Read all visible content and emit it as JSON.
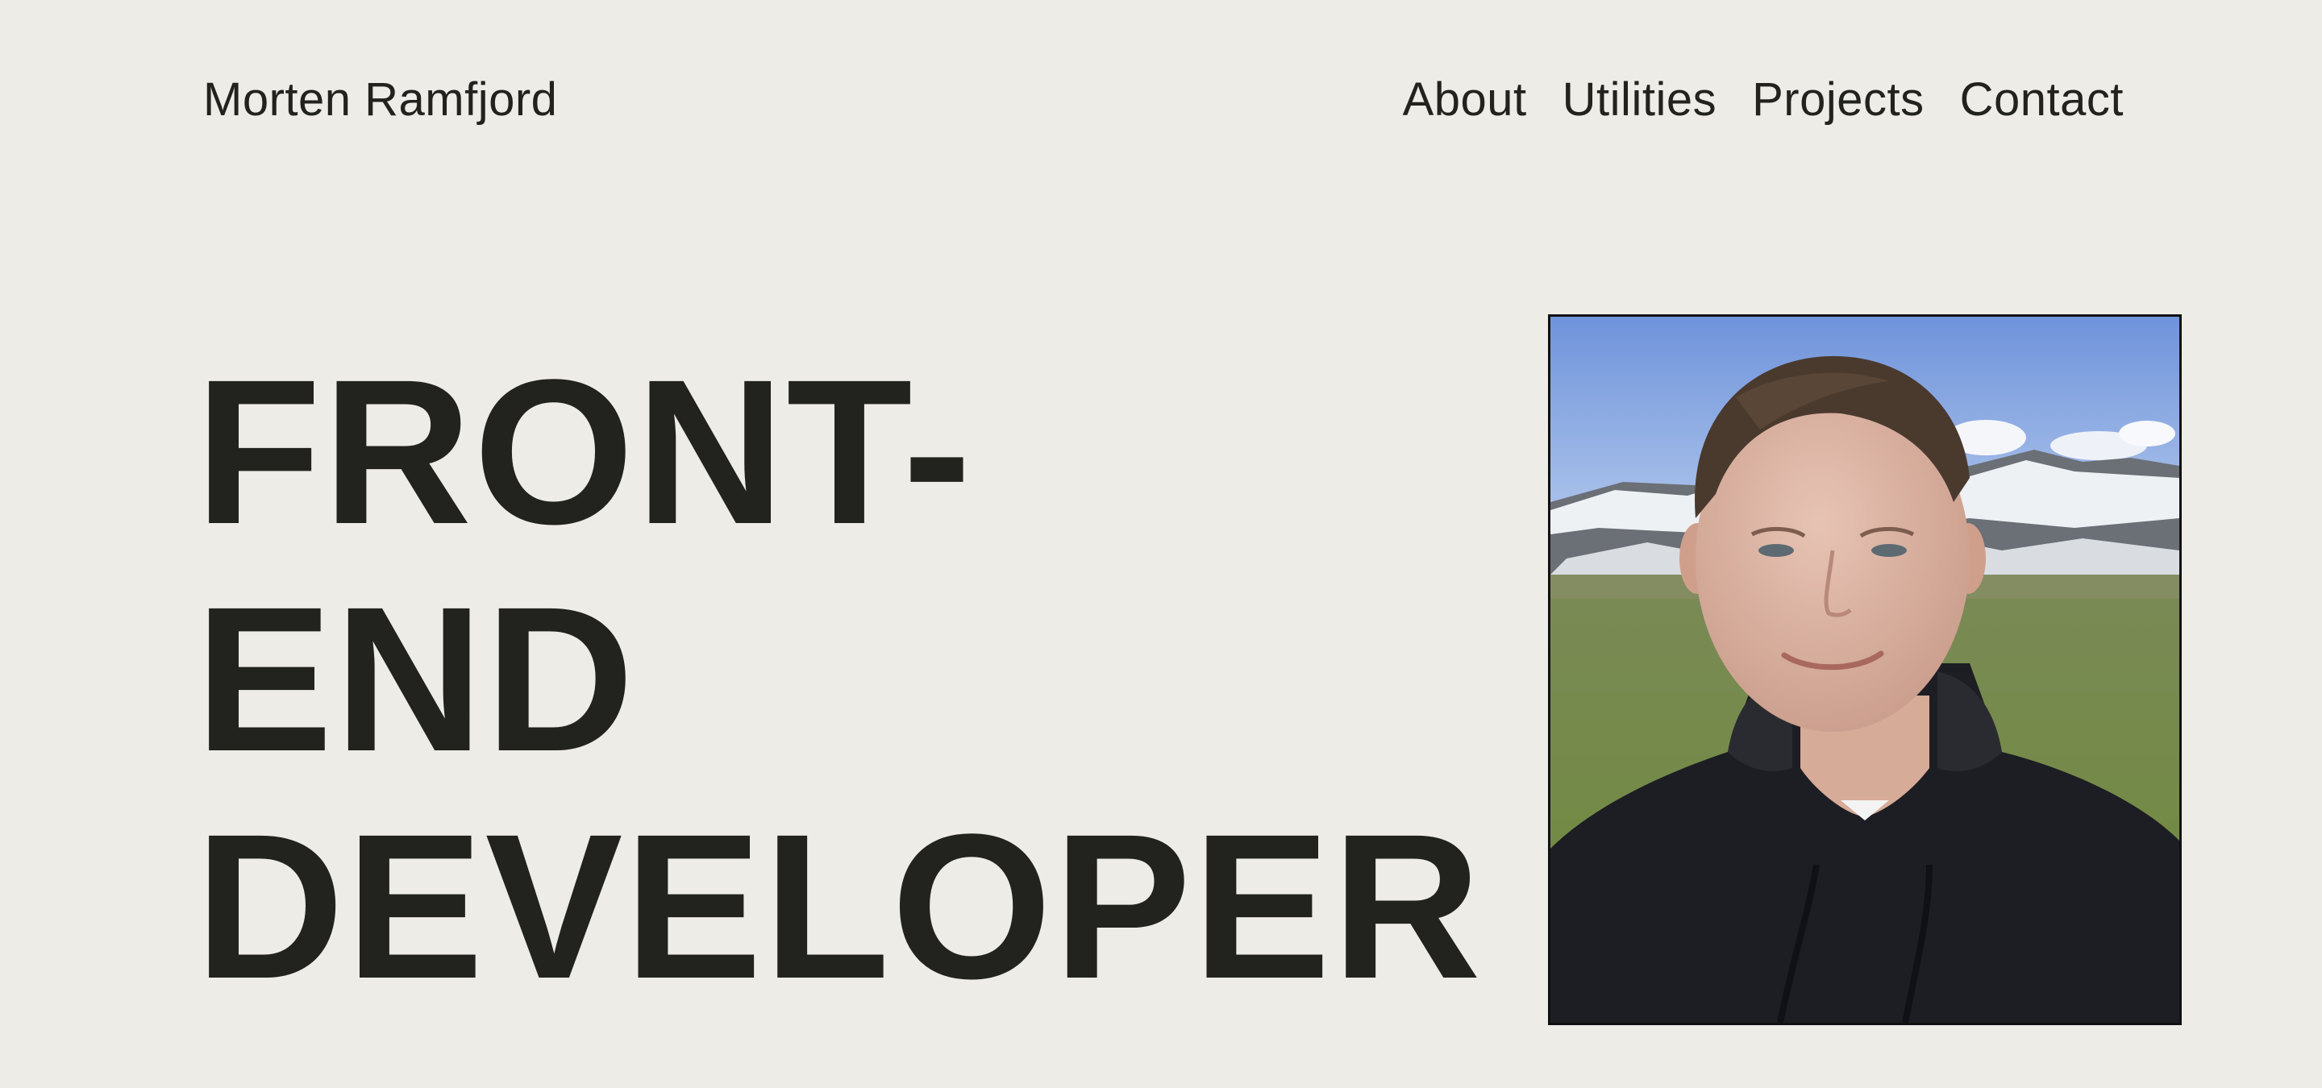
{
  "header": {
    "site_name": "Morten Ramfjord",
    "nav": [
      {
        "label": "About"
      },
      {
        "label": "Utilities"
      },
      {
        "label": "Projects"
      },
      {
        "label": "Contact"
      }
    ]
  },
  "hero": {
    "title_lines": [
      "FRONT-",
      "END",
      "DEVELOPER"
    ]
  },
  "colors": {
    "background": "#edece6",
    "text": "#22221e",
    "frame": "#111111"
  }
}
